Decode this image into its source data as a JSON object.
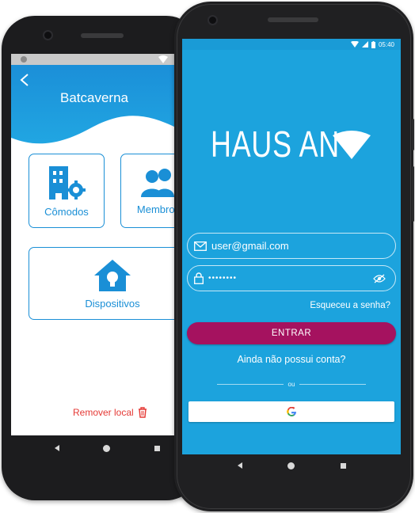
{
  "back_screen": {
    "title": "Batcaverna",
    "back_icon": "chevron-left-icon",
    "cards": [
      {
        "label": "Cômodos",
        "icon": "building-gear-icon"
      },
      {
        "label": "Membros",
        "icon": "users-icon"
      },
      {
        "label": "Dispositivos",
        "icon": "house-bulb-icon"
      }
    ],
    "remove_label": "Remover local",
    "remove_icon": "trash-icon",
    "colors": {
      "primary": "#1a8fd6",
      "danger": "#e53935"
    }
  },
  "front_screen": {
    "status_time": "05:40",
    "logo_text": "HAUS AN",
    "logo_icon": "wifi-triangle-icon",
    "email_value": "user@gmail.com",
    "email_icon": "mail-icon",
    "password_value": "••••••••",
    "lock_icon": "lock-icon",
    "eye_icon": "eye-off-icon",
    "forgot_label": "Esqueceu a senha?",
    "enter_label": "ENTRAR",
    "signup_label": "Ainda não possui conta?",
    "divider_label": "ou",
    "google_icon": "google-icon",
    "colors": {
      "background": "#1ca3dd",
      "enter_button": "#a5125f"
    }
  }
}
